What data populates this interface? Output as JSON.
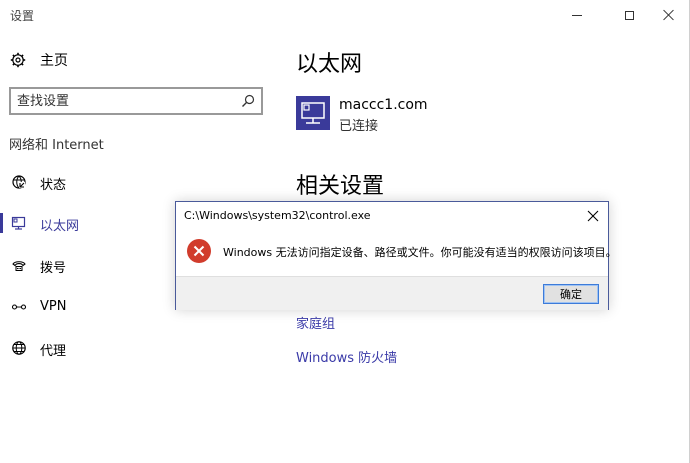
{
  "window": {
    "title": "设置"
  },
  "sidebar": {
    "home_label": "主页",
    "search_placeholder": "查找设置",
    "section_label": "网络和 Internet",
    "items": [
      {
        "label": "状态"
      },
      {
        "label": "以太网",
        "active": true
      },
      {
        "label": "拨号"
      },
      {
        "label": "VPN"
      },
      {
        "label": "代理"
      }
    ]
  },
  "main": {
    "heading": "以太网",
    "device": {
      "name": "maccc1.com",
      "status": "已连接"
    },
    "related_heading": "相关设置",
    "links": [
      {
        "label": "家庭组"
      },
      {
        "label": "Windows 防火墙"
      }
    ]
  },
  "dialog": {
    "title": "C:\\Windows\\system32\\control.exe",
    "message": "Windows 无法访问指定设备、路径或文件。你可能没有适当的权限访问该项目。",
    "ok_label": "确定"
  },
  "colors": {
    "accent": "#3a3a9a",
    "link": "#3a3aa8",
    "error": "#d13c2c"
  }
}
